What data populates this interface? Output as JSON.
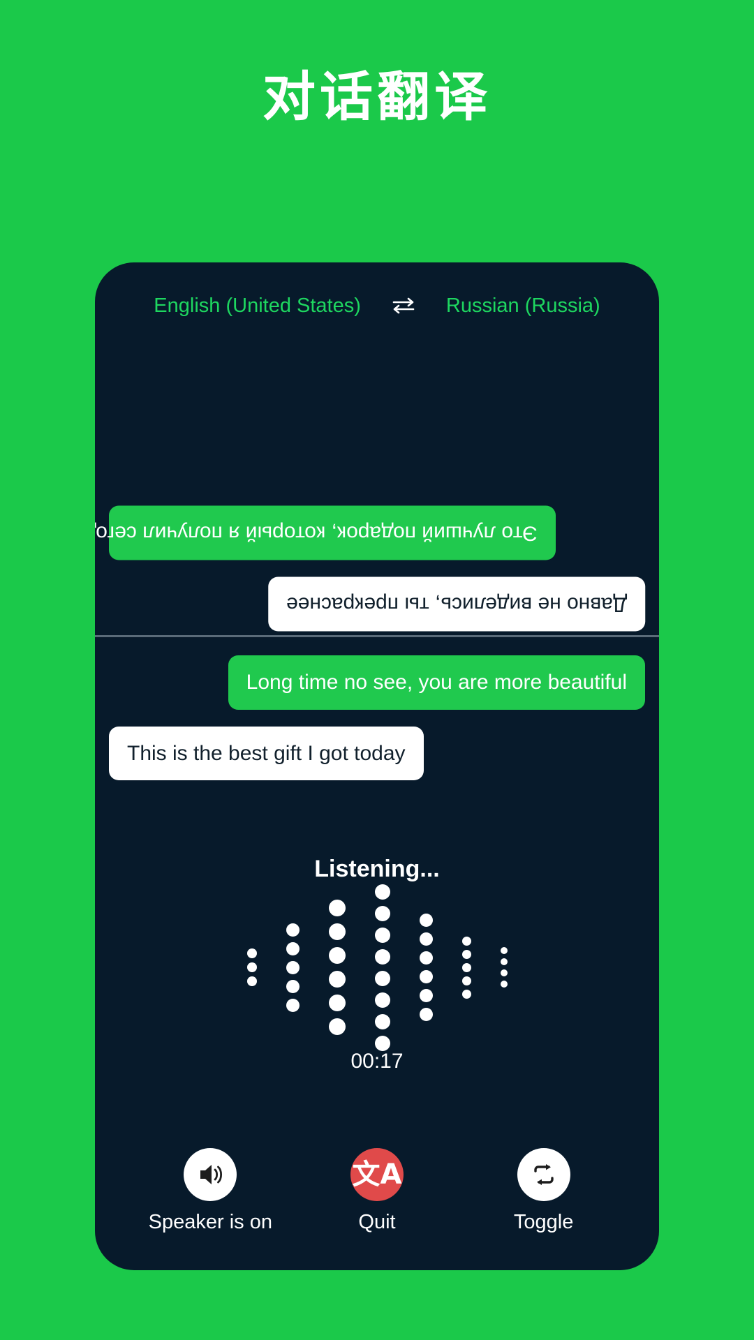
{
  "colors": {
    "background": "#1bc94a",
    "panel": "#071a2b",
    "accent_green": "#20c94e",
    "lang_green": "#1ed760",
    "bubble_white": "#ffffff",
    "quit_red": "#e04a4a",
    "divider": "#5a6b79"
  },
  "header": {
    "title": "对话翻译"
  },
  "language_bar": {
    "source_label": "English (United States)",
    "swap_icon": "swap-horizontal-icon",
    "target_label": "Russian (Russia)"
  },
  "conversation": {
    "top_pane": {
      "orientation": "rotated-180",
      "messages": [
        {
          "side": "left",
          "style": "green",
          "text": "Это лучший подарок, который я получил сегодня"
        },
        {
          "side": "right",
          "style": "white",
          "text": "Давно не виделись, ты прекраснее"
        }
      ]
    },
    "bottom_pane": {
      "orientation": "normal",
      "messages": [
        {
          "side": "right",
          "style": "green",
          "text": "Long time no see, you are more beautiful"
        },
        {
          "side": "left",
          "style": "white",
          "text": "This is the best gift I got today"
        }
      ]
    }
  },
  "status": {
    "listening_label": "Listening...",
    "timer": "00:17"
  },
  "waveform": {
    "columns": [
      {
        "count": 3,
        "size": 14
      },
      {
        "count": 5,
        "size": 19
      },
      {
        "count": 6,
        "size": 24
      },
      {
        "count": 8,
        "size": 22
      },
      {
        "count": 6,
        "size": 19
      },
      {
        "count": 5,
        "size": 13
      },
      {
        "count": 4,
        "size": 10
      }
    ]
  },
  "controls": [
    {
      "icon": "speaker-on-icon",
      "label": "Speaker is on",
      "style": "white"
    },
    {
      "icon": "translate-icon",
      "label": "Quit",
      "style": "red",
      "glyph": "文A"
    },
    {
      "icon": "toggle-repeat-icon",
      "label": "Toggle",
      "style": "white"
    }
  ]
}
